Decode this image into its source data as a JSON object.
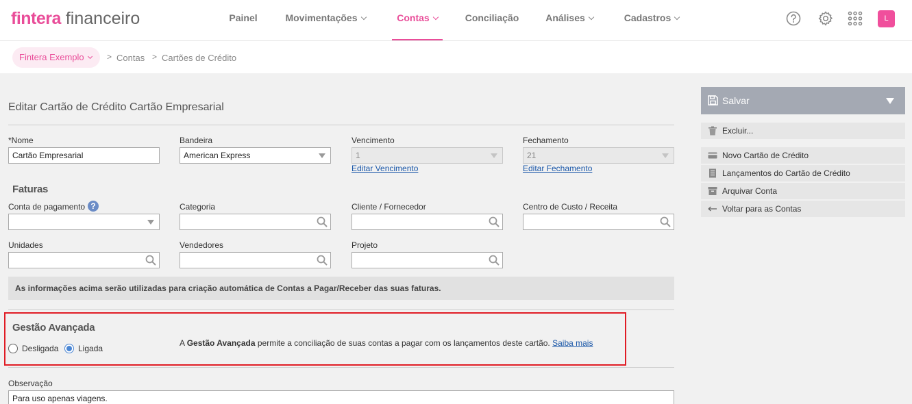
{
  "app": {
    "brand": "fintera",
    "brand_suffix": " financeiro"
  },
  "nav": {
    "items": [
      {
        "label": "Painel"
      },
      {
        "label": "Movimentações"
      },
      {
        "label": "Contas"
      },
      {
        "label": "Conciliação"
      },
      {
        "label": "Análises"
      },
      {
        "label": "Cadastros"
      }
    ],
    "active": "Contas",
    "avatar_initial": "L"
  },
  "breadcrumb": {
    "org": "Fintera Exemplo",
    "items": [
      "Contas",
      "Cartões de Crédito"
    ],
    "separator": ">"
  },
  "form": {
    "title": "Editar Cartão de Crédito Cartão Empresarial",
    "nome": {
      "label": "*Nome",
      "value": "Cartão Empresarial"
    },
    "bandeira": {
      "label": "Bandeira",
      "value": "American Express"
    },
    "vencimento": {
      "label": "Vencimento",
      "value": "1",
      "link": "Editar Vencimento"
    },
    "fechamento": {
      "label": "Fechamento",
      "value": "21",
      "link": "Editar Fechamento"
    },
    "faturas": {
      "heading": "Faturas",
      "conta_pagamento": {
        "label": "Conta de pagamento",
        "value": ""
      },
      "categoria": {
        "label": "Categoria",
        "value": ""
      },
      "cliente_fornecedor": {
        "label": "Cliente / Fornecedor",
        "value": ""
      },
      "centro_custo": {
        "label": "Centro de Custo / Receita",
        "value": ""
      },
      "unidades": {
        "label": "Unidades",
        "value": ""
      },
      "vendedores": {
        "label": "Vendedores",
        "value": ""
      },
      "projeto": {
        "label": "Projeto",
        "value": ""
      },
      "info": "As informações acima serão utilizadas para criação automática de Contas a Pagar/Receber das suas faturas."
    },
    "gestao": {
      "heading": "Gestão Avançada",
      "option_off": "Desligada",
      "option_on": "Ligada",
      "selected": "Ligada",
      "text_prefix": "A ",
      "text_bold": "Gestão Avançada",
      "text_suffix": " permite a conciliação de suas contas a pagar com os lançamentos deste cartão. ",
      "link": "Saiba mais"
    },
    "observacao": {
      "label": "Observação",
      "value": "Para uso apenas viagens."
    }
  },
  "sidebar": {
    "save": "Salvar",
    "delete": "Excluir...",
    "actions": [
      "Novo Cartão de Crédito",
      "Lançamentos do Cartão de Crédito",
      "Arquivar Conta",
      "Voltar para as Contas"
    ]
  },
  "colors": {
    "brand": "#e94d99",
    "link": "#1a57a8",
    "highlight_border": "#e01b24",
    "save_button": "#a4a9b3",
    "radio_on": "#4a86d4"
  }
}
